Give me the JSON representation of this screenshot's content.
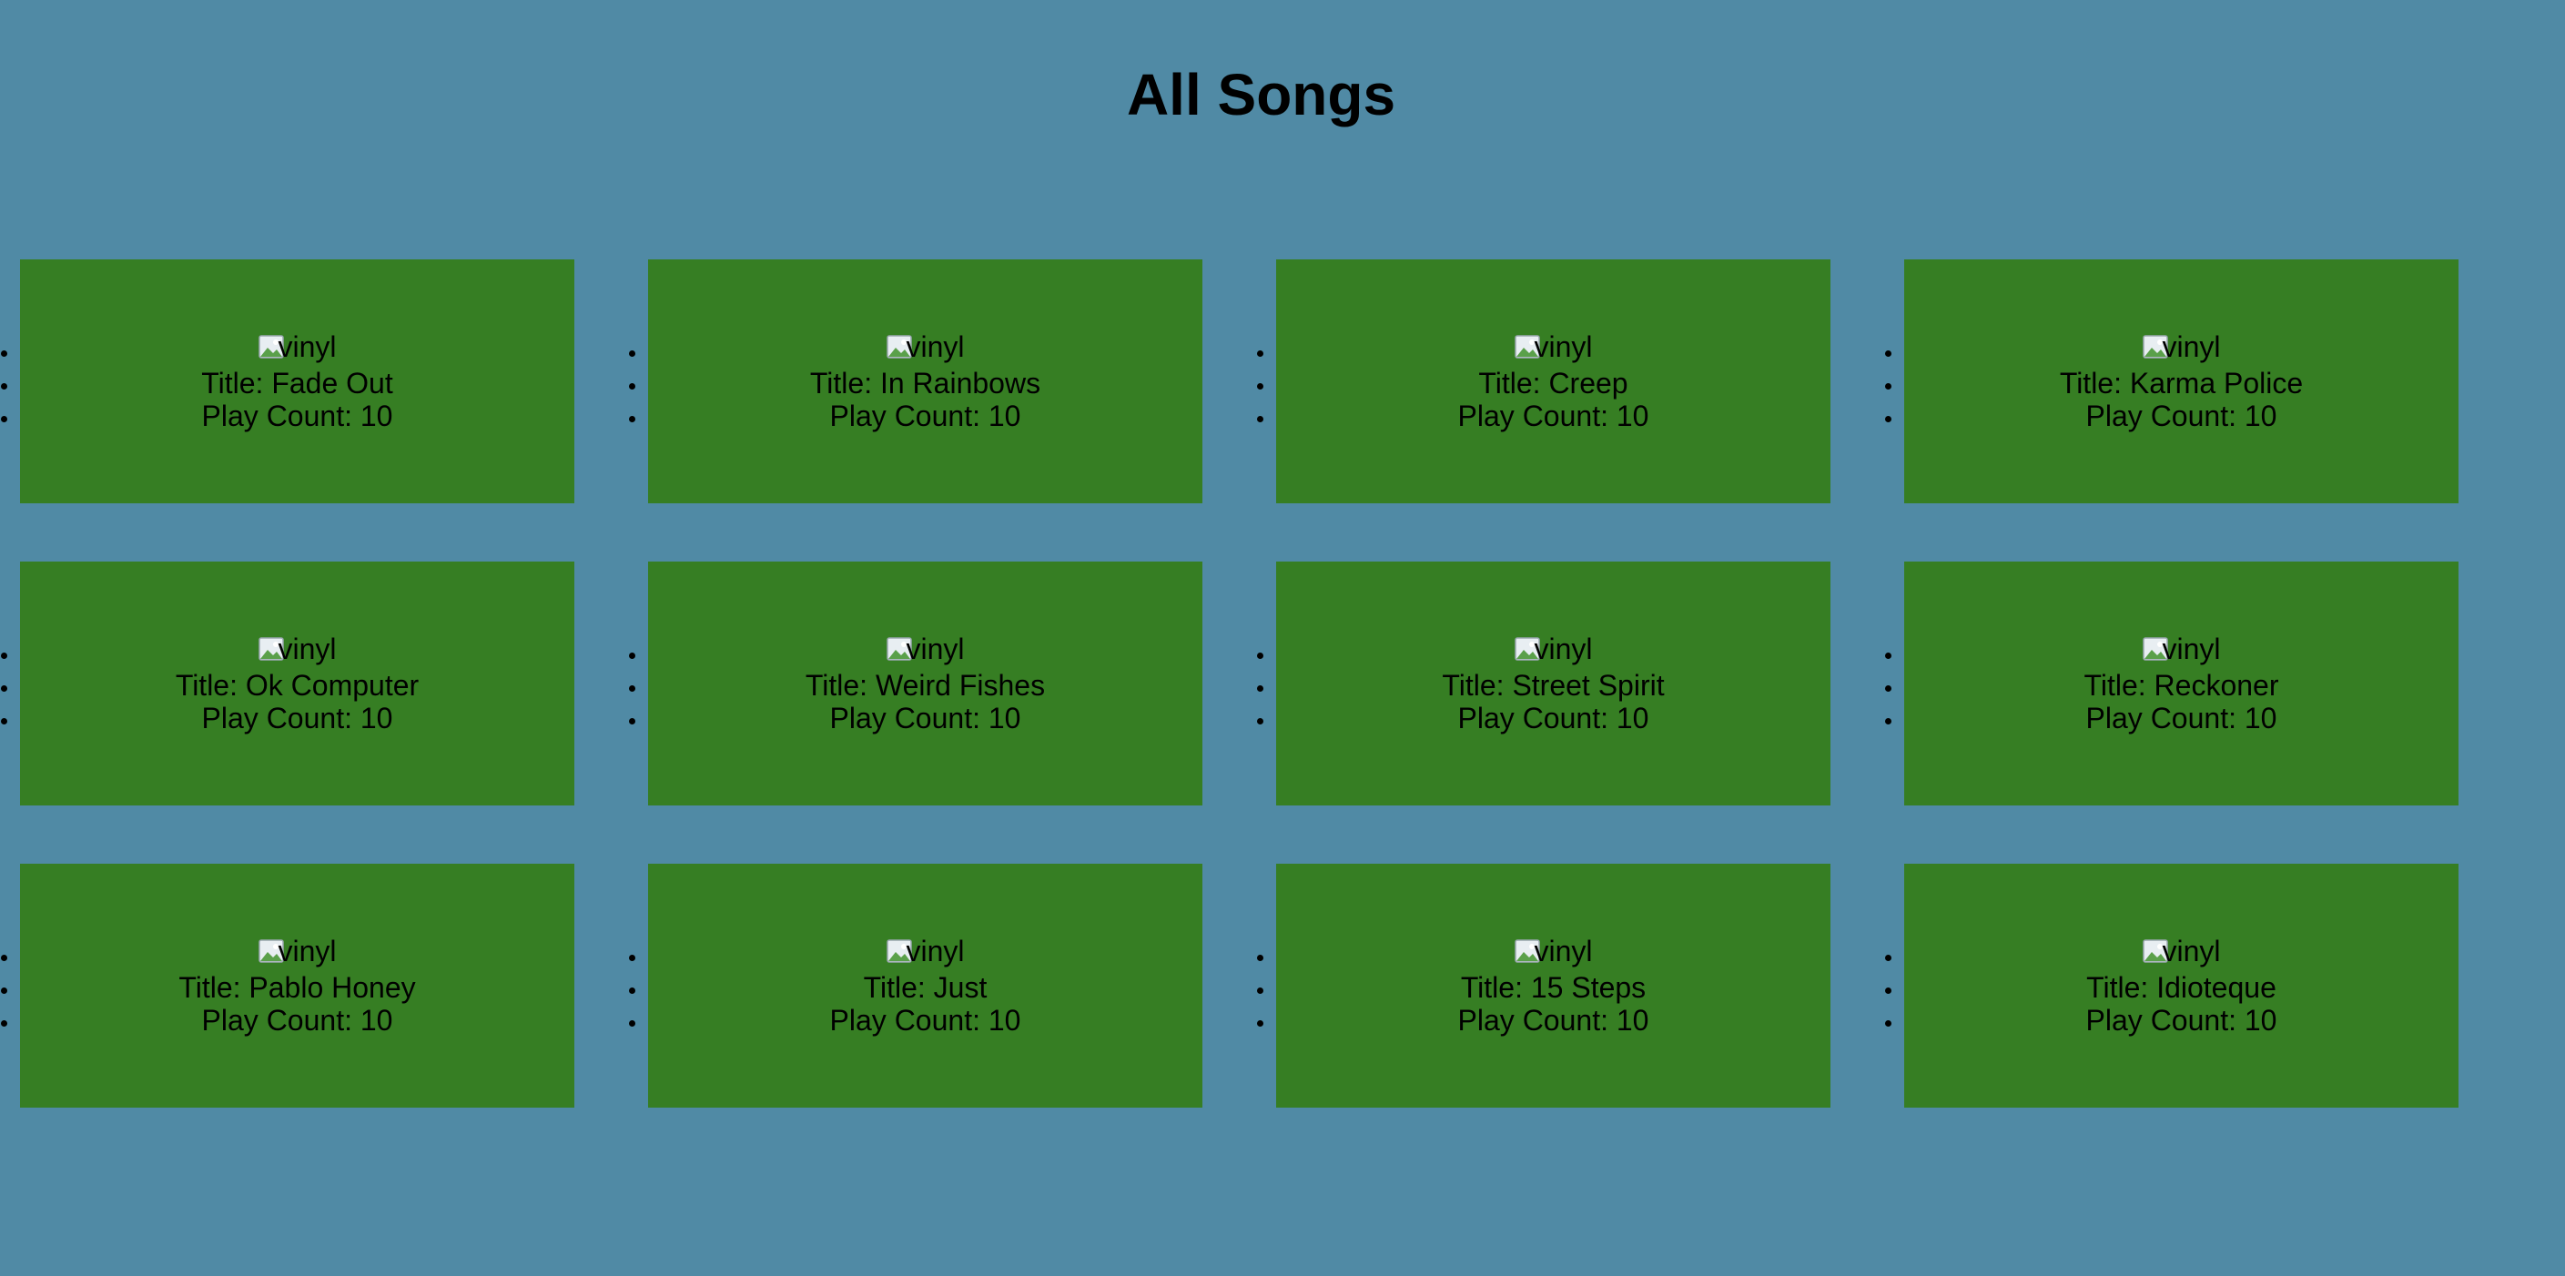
{
  "page": {
    "title": "All Songs"
  },
  "songs": [
    {
      "image_alt": "vinyl",
      "title_line": "Title: Fade Out",
      "play_line": "Play Count: 10"
    },
    {
      "image_alt": "vinyl",
      "title_line": "Title: In Rainbows",
      "play_line": "Play Count: 10"
    },
    {
      "image_alt": "vinyl",
      "title_line": "Title: Creep",
      "play_line": "Play Count: 10"
    },
    {
      "image_alt": "vinyl",
      "title_line": "Title: Karma Police",
      "play_line": "Play Count: 10"
    },
    {
      "image_alt": "vinyl",
      "title_line": "Title: Ok Computer",
      "play_line": "Play Count: 10"
    },
    {
      "image_alt": "vinyl",
      "title_line": "Title: Weird Fishes",
      "play_line": "Play Count: 10"
    },
    {
      "image_alt": "vinyl",
      "title_line": "Title: Street Spirit",
      "play_line": "Play Count: 10"
    },
    {
      "image_alt": "vinyl",
      "title_line": "Title: Reckoner",
      "play_line": "Play Count: 10"
    },
    {
      "image_alt": "vinyl",
      "title_line": "Title: Pablo Honey",
      "play_line": "Play Count: 10"
    },
    {
      "image_alt": "vinyl",
      "title_line": "Title: Just",
      "play_line": "Play Count: 10"
    },
    {
      "image_alt": "vinyl",
      "title_line": "Title: 15 Steps",
      "play_line": "Play Count: 10"
    },
    {
      "image_alt": "vinyl",
      "title_line": "Title: Idioteque",
      "play_line": "Play Count: 10"
    }
  ],
  "icons": {
    "broken_image": "broken-image-icon"
  },
  "colors": {
    "background": "#508aa5",
    "card": "#367e23"
  }
}
